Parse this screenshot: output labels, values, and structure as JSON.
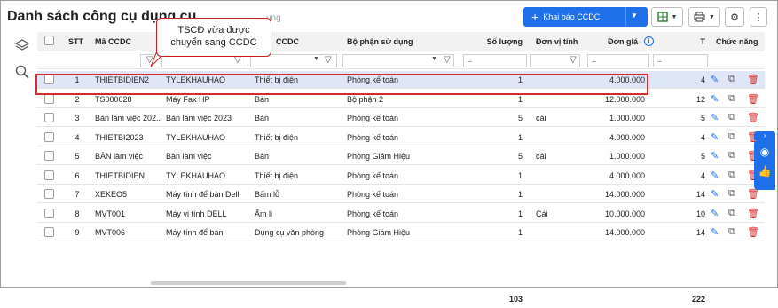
{
  "page": {
    "title": "Danh sách công cụ dụng cụ",
    "title_fragment": "ụng"
  },
  "callout": {
    "text_line1": "TSCĐ vừa được",
    "text_line2": "chuyển sang CCDC"
  },
  "toolbar": {
    "primary_label": "Khai báo CCDC",
    "primary_icon": "plus-icon",
    "caret_icon": "chevron-down-icon",
    "btn_excel_icon": "excel-icon",
    "btn_print_icon": "print-icon",
    "btn_settings_icon": "gear-icon",
    "btn_more_icon": "more-icon",
    "accent_color": "#1e6fe8"
  },
  "left_rail": {
    "icon1": "layers-icon",
    "icon2": "search-icon"
  },
  "table": {
    "headers": {
      "stt": "STT",
      "ma": "Mã CCDC",
      "ten": "CCDC",
      "bophan": "Bộ phận sử dụng",
      "soluong": "Số lượng",
      "dvt": "Đơn vị tính",
      "dongia": "Đơn giá",
      "t": "T",
      "chucnang": "Chức năng"
    },
    "filter_ops": {
      "soluong": "=",
      "dongia": "=",
      "t": "="
    },
    "rows": [
      {
        "stt": "1",
        "ma": "THIETBIDIEN2",
        "ten": "TYLEKHAUHAO",
        "loai": "Thiết bị điện",
        "bophan": "Phòng kế toán",
        "soluong": "1",
        "dvt": "",
        "dongia": "4.000.000",
        "t": "4"
      },
      {
        "stt": "2",
        "ma": "TS000028",
        "ten": "Máy Fax HP",
        "loai": "Bàn",
        "bophan": "Bộ phận 2",
        "soluong": "1",
        "dvt": "",
        "dongia": "12.000.000",
        "t": "12"
      },
      {
        "stt": "3",
        "ma": "Bàn làm việc 202...",
        "ten": "Bàn làm việc 2023",
        "loai": "Bàn",
        "bophan": "Phòng kế toán",
        "soluong": "5",
        "dvt": "cái",
        "dongia": "1.000.000",
        "t": "5"
      },
      {
        "stt": "4",
        "ma": "THIETBI2023",
        "ten": "TYLEKHAUHAO",
        "loai": "Thiết bị điện",
        "bophan": "Phòng kế toán",
        "soluong": "1",
        "dvt": "",
        "dongia": "4.000.000",
        "t": "4"
      },
      {
        "stt": "5",
        "ma": "BÀN làm việc",
        "ten": "Bàn làm việc",
        "loai": "Bàn",
        "bophan": "Phòng Giám Hiệu",
        "soluong": "5",
        "dvt": "cái",
        "dongia": "1.000.000",
        "t": "5"
      },
      {
        "stt": "6",
        "ma": "THIETBIDIEN",
        "ten": "TYLEKHAUHAO",
        "loai": "Thiết bị điện",
        "bophan": "Phòng kế toán",
        "soluong": "1",
        "dvt": "",
        "dongia": "4.000.000",
        "t": "4"
      },
      {
        "stt": "7",
        "ma": "XEKEO5",
        "ten": "Máy tính để bàn Dell",
        "loai": "Bấm lỗ",
        "bophan": "Phòng kế toán",
        "soluong": "1",
        "dvt": "",
        "dongia": "14.000.000",
        "t": "14"
      },
      {
        "stt": "8",
        "ma": "MVT001",
        "ten": "Máy vi tính DELL",
        "loai": "Ấm li",
        "bophan": "Phòng kế toán",
        "soluong": "1",
        "dvt": "Cái",
        "dongia": "10.000.000",
        "t": "10"
      },
      {
        "stt": "9",
        "ma": "MVT006",
        "ten": "Máy tính để bàn",
        "loai": "Dụng cụ văn phòng",
        "bophan": "Phòng Giám Hiệu",
        "soluong": "1",
        "dvt": "",
        "dongia": "14.000.000",
        "t": "14"
      }
    ],
    "totals": {
      "soluong": "103",
      "t": "222"
    }
  },
  "side_widget": {
    "icon1": "chat-icon",
    "icon2": "thumbs-up-icon"
  }
}
